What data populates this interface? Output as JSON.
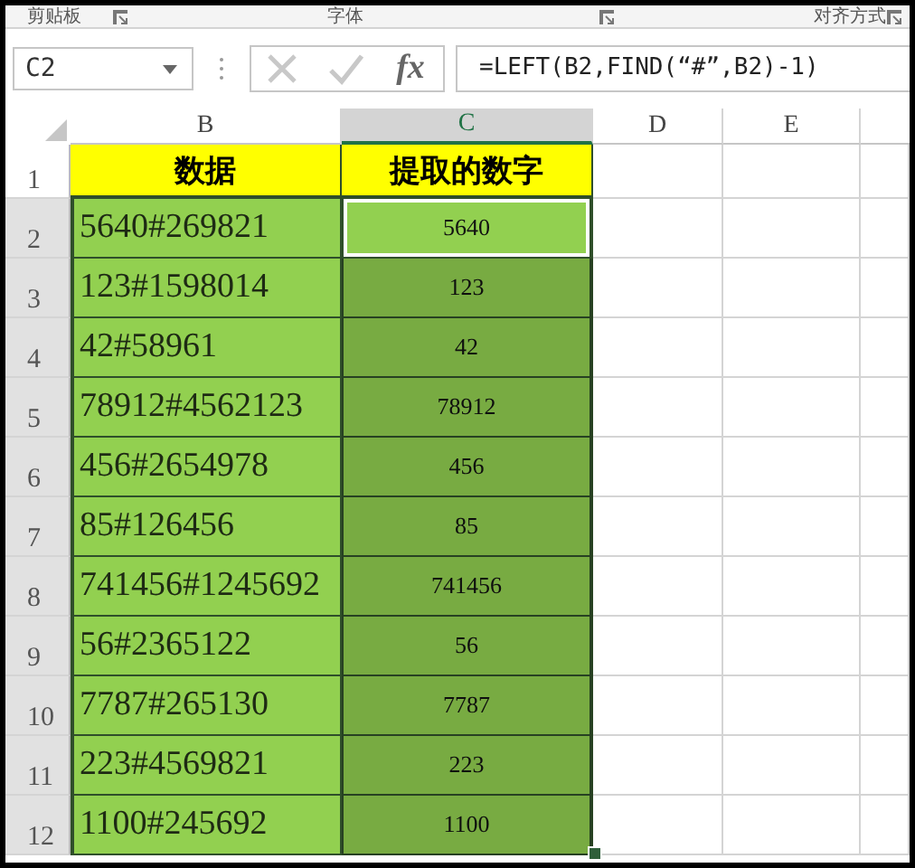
{
  "ribbon_groups": [
    "剪贴板",
    "字体",
    "对齐方式"
  ],
  "formula_bar": {
    "name_box": "C2",
    "function_label": "fx",
    "formula": "=LEFT(B2,FIND(“#”,B2)-1)"
  },
  "columns": [
    {
      "label": "B",
      "selected": false
    },
    {
      "label": "C",
      "selected": true
    },
    {
      "label": "D",
      "selected": false
    },
    {
      "label": "E",
      "selected": false
    }
  ],
  "rows": [
    {
      "number": "1",
      "kind": "header",
      "selected": false,
      "cells": [
        {
          "text": "数据",
          "selected": false,
          "active": false
        },
        {
          "text": "提取的数字",
          "selected": false,
          "active": false
        }
      ]
    },
    {
      "number": "2",
      "kind": "data",
      "selected": true,
      "cells": [
        {
          "text": "5640#269821",
          "selected": false,
          "active": false
        },
        {
          "text": "5640",
          "selected": true,
          "active": true
        }
      ]
    },
    {
      "number": "3",
      "kind": "data",
      "selected": true,
      "cells": [
        {
          "text": "123#1598014",
          "selected": false,
          "active": false
        },
        {
          "text": "123",
          "selected": true,
          "active": false
        }
      ]
    },
    {
      "number": "4",
      "kind": "data",
      "selected": true,
      "cells": [
        {
          "text": "42#58961",
          "selected": false,
          "active": false
        },
        {
          "text": "42",
          "selected": true,
          "active": false
        }
      ]
    },
    {
      "number": "5",
      "kind": "data",
      "selected": true,
      "cells": [
        {
          "text": "78912#4562123",
          "selected": false,
          "active": false
        },
        {
          "text": "78912",
          "selected": true,
          "active": false
        }
      ]
    },
    {
      "number": "6",
      "kind": "data",
      "selected": true,
      "cells": [
        {
          "text": "456#2654978",
          "selected": false,
          "active": false
        },
        {
          "text": "456",
          "selected": true,
          "active": false
        }
      ]
    },
    {
      "number": "7",
      "kind": "data",
      "selected": true,
      "cells": [
        {
          "text": "85#126456",
          "selected": false,
          "active": false
        },
        {
          "text": "85",
          "selected": true,
          "active": false
        }
      ]
    },
    {
      "number": "8",
      "kind": "data",
      "selected": true,
      "cells": [
        {
          "text": "741456#1245692",
          "selected": false,
          "active": false
        },
        {
          "text": "741456",
          "selected": true,
          "active": false
        }
      ]
    },
    {
      "number": "9",
      "kind": "data",
      "selected": true,
      "cells": [
        {
          "text": "56#2365122",
          "selected": false,
          "active": false
        },
        {
          "text": "56",
          "selected": true,
          "active": false
        }
      ]
    },
    {
      "number": "10",
      "kind": "data",
      "selected": true,
      "cells": [
        {
          "text": "7787#265130",
          "selected": false,
          "active": false
        },
        {
          "text": "7787",
          "selected": true,
          "active": false
        }
      ]
    },
    {
      "number": "11",
      "kind": "data",
      "selected": true,
      "cells": [
        {
          "text": "223#4569821",
          "selected": false,
          "active": false
        },
        {
          "text": "223",
          "selected": true,
          "active": false
        }
      ]
    },
    {
      "number": "12",
      "kind": "data",
      "selected": true,
      "cells": [
        {
          "text": "1100#245692",
          "selected": false,
          "active": false
        },
        {
          "text": "1100",
          "selected": true,
          "active": false
        }
      ]
    }
  ]
}
